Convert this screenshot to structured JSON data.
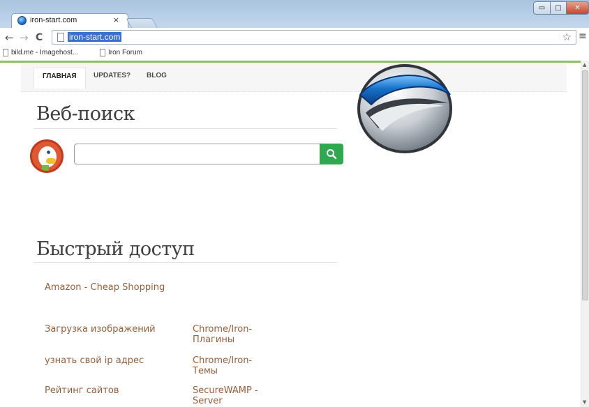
{
  "tab": {
    "title": "iron-start.com",
    "close": "×"
  },
  "window": {
    "minimize": "▭",
    "maximize": "□",
    "close": "✕"
  },
  "toolbar": {
    "back": "←",
    "forward": "→",
    "reload": "C",
    "url": "iron-start.com",
    "star": "☆",
    "menu": "≡"
  },
  "bookmarks": [
    {
      "label": "bild.me - Imagehost..."
    },
    {
      "label": "Iron Forum"
    }
  ],
  "nav": {
    "home": "ГЛАВНАЯ",
    "updates": "UPDATES?",
    "blog": "BLOG"
  },
  "search": {
    "title": "Веб-поиск",
    "placeholder": ""
  },
  "quick": {
    "title": "Быстрый доступ",
    "links": [
      "Amazon - Cheap Shopping",
      "Загрузка изображений",
      "Chrome/Iron-Плагины",
      "узнать свой ip адрес",
      "Chrome/Iron-Темы",
      "Рейтинг сайтов",
      "SecureWAMP - Server"
    ]
  },
  "colors": {
    "accent": "#8ec06c",
    "link": "#9b5d3a",
    "search_button": "#2fa84f"
  }
}
